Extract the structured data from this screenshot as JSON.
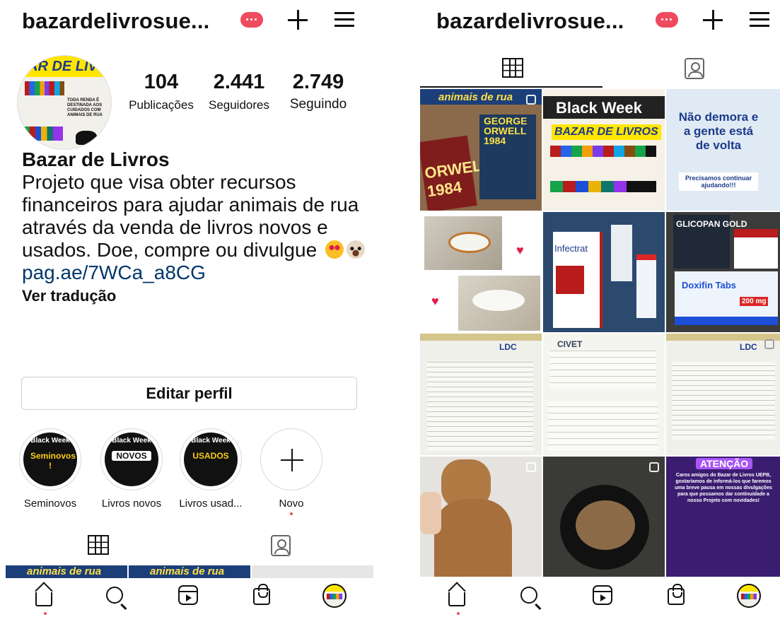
{
  "profile": {
    "username": "bazardelivrosue...",
    "notif_count_label": "",
    "display_name": "Bazar de Livros",
    "bio_text": "Projeto que visa obter recursos financeiros para ajudar animais de rua através da venda de livros novos e usados. Doe, compre ou divulgue",
    "bio_link": "pag.ae/7WCa_a8CG",
    "see_translation": "Ver tradução",
    "edit_profile": "Editar perfil",
    "avatar_title": "AR DE LIV",
    "avatar_text": "TODA RENDA É DESTINADA AOS CUIDADOS COM ANIMAIS DE RUA"
  },
  "stats": [
    {
      "num": "104",
      "label": "Publicações"
    },
    {
      "num": "2.441",
      "label": "Seguidores"
    },
    {
      "num": "2.749",
      "label": "Seguindo"
    }
  ],
  "highlights": [
    {
      "label": "Seminovos",
      "top": "Black Week",
      "mid": "Seminovos !",
      "mid_color": "#facc15"
    },
    {
      "label": "Livros novos",
      "top": "Black Week",
      "mid": "NOVOS",
      "mid_color": "#ffffff"
    },
    {
      "label": "Livros usad...",
      "top": "Black Week",
      "mid": "USADOS",
      "mid_color": "#facc15"
    },
    {
      "label": "Novo"
    }
  ],
  "peek_posts": [
    "animais de rua",
    "animais de rua"
  ],
  "posts": [
    {
      "title": "animais de rua",
      "sub": "GEORGE ORWELL 1984"
    },
    {
      "title": "Black Week",
      "sub": "BAZAR DE LIVROS"
    },
    {
      "title": "Não demora e a gente está de volta",
      "sub": "Precisamos continuar ajudando!!!"
    },
    {
      "title": ""
    },
    {
      "title": "Infectrat"
    },
    {
      "title": "GLICOPAN GOLD",
      "sub": "Doxifin Tabs",
      "extra": "200 mg"
    },
    {
      "title": "LDC"
    },
    {
      "title": "CIVET"
    },
    {
      "title": "LDC"
    },
    {
      "title": ""
    },
    {
      "title": ""
    },
    {
      "title": "ATENÇÃO",
      "sub": "Caros amigos do Bazar de Livros UEPB, gostaríamos de informá-los que faremos uma breve pausa em nossas divulgações para que possamos dar continuidade a nosso Projeto com novidades!"
    }
  ],
  "nav": [
    "home-icon",
    "search-icon",
    "reels-icon",
    "shop-icon",
    "profile-avatar"
  ],
  "colors": {
    "accent": "#ef4b5e",
    "link": "#00376b",
    "navy": "#1c3f7a",
    "yellow": "#ffe600"
  }
}
